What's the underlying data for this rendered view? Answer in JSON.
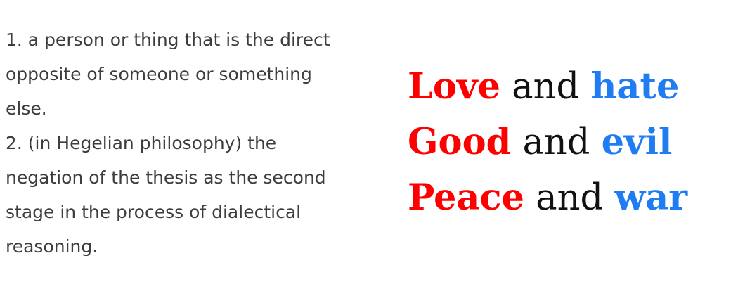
{
  "definition": {
    "item1": "1. a person or thing that is the direct opposite of someone or something else.",
    "item2": "2. (in Hegelian philosophy) the negation of the thesis as the second stage in the process of dialectical reasoning."
  },
  "pairs": [
    {
      "first": "Love",
      "connector": "and",
      "second": "hate"
    },
    {
      "first": "Good",
      "connector": "and",
      "second": "evil"
    },
    {
      "first": "Peace",
      "connector": "and",
      "second": "war"
    }
  ],
  "colors": {
    "first_word": "#ff0000",
    "second_word": "#1f7cf2",
    "body_text": "#3d3d3d"
  }
}
